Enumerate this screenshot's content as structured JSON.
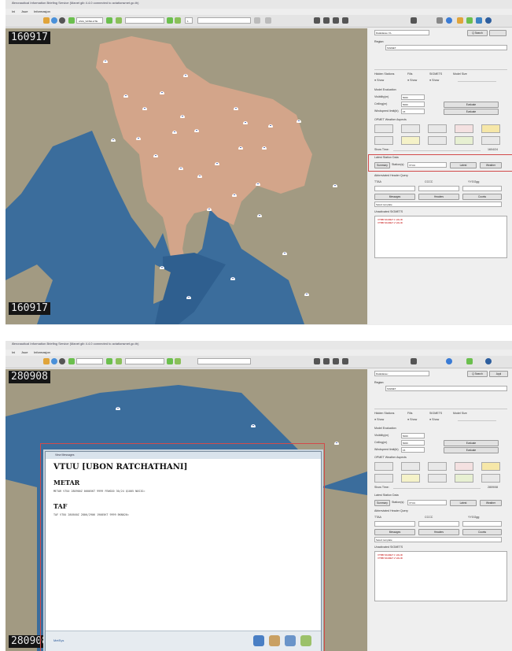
{
  "shot1": {
    "window_title": "Aeronautical Information Briefing Service (Manet gib 4.4.0 connected to aviationsmet.go.th)",
    "menu": [
      "Ini",
      "Jsue",
      "Informasjon"
    ],
    "toolbar": {
      "layer_combo": "ASIA_SATELLITE",
      "zoom_value": "1"
    },
    "timestamp_top": "160917",
    "timestamp_bottom": "160917",
    "panel": {
      "dataset_label": "Dataklasse:",
      "dataset_value": "FL",
      "search_label": "Q Search",
      "region_label": "Region:",
      "region_value": "SIGMET",
      "hidden_stations": "Hidden Stations",
      "fills": "Fills",
      "sigmets": "SIGMETS",
      "model_size": "Model Size",
      "show": "Show",
      "model_evaluation": "Model Evaluation",
      "visibility_label": "Visibility(m)",
      "visibility_value": "5000",
      "ceiling_label": "Ceiling(m)",
      "ceiling_value": "5000",
      "windspeed_label": "Windspeed limit(kt)",
      "windspeed_value": "15",
      "evaluate": "Evaluate",
      "opmet_weather_aspects": "OPMET Weather Aspects",
      "show_time": "Show Time:",
      "show_time_value": "1604/24",
      "latest_station_data": "Latest Station Data",
      "summary": "Summary",
      "station_label": "Station(s):",
      "station_value": "VTUU",
      "latest": "Latest",
      "weather": "Weather",
      "abbreviated_header_query": "Abbreviated Header Query",
      "ttaa": "TTAA",
      "cccc": "CCCC",
      "yygg": "YYGGgg",
      "messages": "Messages",
      "headers": "Headers",
      "counts": "Counts",
      "select_template": "Select template",
      "unactivated_sigmets": "Unactivated SIGMETS",
      "sigmet_lines": [
        "VTBB SIGMET 1 VALID",
        "VTBB SIGMET 2 VALID"
      ]
    }
  },
  "shot2": {
    "window_title": "Aeronautical Information Briefing Service (Manet gib 4.4.0 connected to aviationsmet.go.th)",
    "menu": [
      "Ini",
      "Jsue",
      "Informasjon"
    ],
    "timestamp_top": "280908",
    "timestamp_bottom": "280908",
    "dialog": {
      "title": "View Messages",
      "station_heading": "VTUU [UBON RATCHATHANI]",
      "metar_heading": "METAR",
      "metar_text": "METAR VTUU 280900Z 06005KT 9999 FEW020 30/24 Q1005 NOSIG=",
      "taf_heading": "TAF",
      "taf_text": "TAF VTUU 280500Z 2806/2906 19005KT 9999 BKN020=",
      "logo_text": "MetSys"
    },
    "panel": {
      "dataset_label": "Dataklasse:",
      "search_label": "Q Search",
      "apply_label": "Appl",
      "region_label": "Region:",
      "region_value": "SIGMET",
      "hidden_stations": "Hidden Stations",
      "fills": "Fills",
      "sigmets": "SIGMETS",
      "model_size": "Model Size",
      "show": "Show",
      "model_evaluation": "Model Evaluation",
      "visibility_label": "Visibility(m)",
      "visibility_value": "5000",
      "ceiling_label": "Ceiling(m)",
      "ceiling_value": "5000",
      "windspeed_label": "Windspeed limit(kt)",
      "windspeed_value": "15",
      "evaluate": "Evaluate",
      "opmet_weather_aspects": "OPMET Weather Aspects",
      "show_time": "Show Time:",
      "show_time_value": "2809/08",
      "latest_station_data": "Latest Station Data",
      "summary": "Summary",
      "station_label": "Station(s):",
      "station_value": "VTUU",
      "latest": "Latest",
      "weather": "Weather",
      "abbreviated_header_query": "Abbreviated Header Query",
      "ttaa": "TTAA",
      "cccc": "CCCC",
      "yygg": "YYGGgg",
      "messages": "Messages",
      "headers": "Headers",
      "counts": "Counts",
      "select_template": "Select template",
      "unactivated_sigmets": "Unactivated SIGMETS",
      "sigmet_lines": [
        "VTBB SIGMET 1 VALID",
        "VTBB SIGMET 2 VALID"
      ]
    }
  },
  "colors": {
    "sea": "#3b6d9c",
    "land": "#a29a82",
    "country_fill": "#d3a58a",
    "highlight": "#d24a4a",
    "sigmet_text": "#c00000"
  }
}
